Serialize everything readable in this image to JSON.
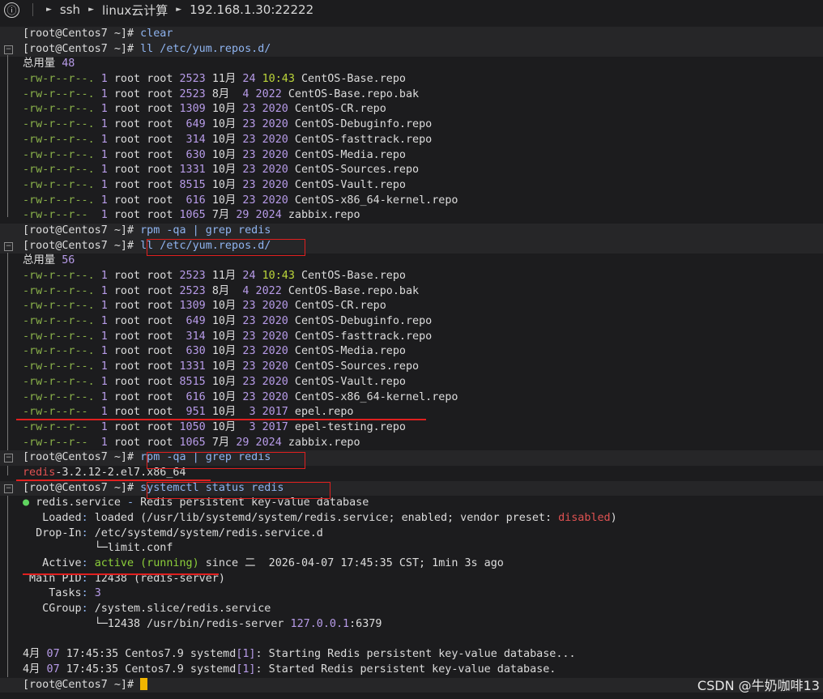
{
  "titlebar": {
    "info_icon_glyph": "ⓘ",
    "crumbs": [
      "ssh",
      "linux云计算",
      "192.168.1.30:22222"
    ]
  },
  "prompt": "[root@Centos7 ~]#",
  "watermark": "CSDN @牛奶咖啡13",
  "lines": [
    {
      "type": "prompt",
      "cmd": "clear"
    },
    {
      "type": "prompt",
      "cmd": "ll /etc/yum.repos.d/",
      "gutter": true
    },
    {
      "type": "total",
      "label": "总用量",
      "value": "48"
    },
    {
      "type": "file",
      "perm": "-rw-r--r--.",
      "links": "1",
      "owner": "root",
      "group": "root",
      "size": "2523",
      "mon": "11月",
      "day": "24",
      "t": "10:43",
      "tcolor": "time",
      "name": "CentOS-Base.repo"
    },
    {
      "type": "file",
      "perm": "-rw-r--r--.",
      "links": "1",
      "owner": "root",
      "group": "root",
      "size": "2523",
      "mon": "8月",
      "day": " 4",
      "t": "2022",
      "name": "CentOS-Base.repo.bak"
    },
    {
      "type": "file",
      "perm": "-rw-r--r--.",
      "links": "1",
      "owner": "root",
      "group": "root",
      "size": "1309",
      "mon": "10月",
      "day": "23",
      "t": "2020",
      "name": "CentOS-CR.repo"
    },
    {
      "type": "file",
      "perm": "-rw-r--r--.",
      "links": "1",
      "owner": "root",
      "group": "root",
      "size": " 649",
      "mon": "10月",
      "day": "23",
      "t": "2020",
      "name": "CentOS-Debuginfo.repo"
    },
    {
      "type": "file",
      "perm": "-rw-r--r--.",
      "links": "1",
      "owner": "root",
      "group": "root",
      "size": " 314",
      "mon": "10月",
      "day": "23",
      "t": "2020",
      "name": "CentOS-fasttrack.repo"
    },
    {
      "type": "file",
      "perm": "-rw-r--r--.",
      "links": "1",
      "owner": "root",
      "group": "root",
      "size": " 630",
      "mon": "10月",
      "day": "23",
      "t": "2020",
      "name": "CentOS-Media.repo"
    },
    {
      "type": "file",
      "perm": "-rw-r--r--.",
      "links": "1",
      "owner": "root",
      "group": "root",
      "size": "1331",
      "mon": "10月",
      "day": "23",
      "t": "2020",
      "name": "CentOS-Sources.repo"
    },
    {
      "type": "file",
      "perm": "-rw-r--r--.",
      "links": "1",
      "owner": "root",
      "group": "root",
      "size": "8515",
      "mon": "10月",
      "day": "23",
      "t": "2020",
      "name": "CentOS-Vault.repo"
    },
    {
      "type": "file",
      "perm": "-rw-r--r--.",
      "links": "1",
      "owner": "root",
      "group": "root",
      "size": " 616",
      "mon": "10月",
      "day": "23",
      "t": "2020",
      "name": "CentOS-x86_64-kernel.repo"
    },
    {
      "type": "file",
      "perm": "-rw-r--r-- ",
      "links": "1",
      "owner": "root",
      "group": "root",
      "size": "1065",
      "mon": "7月",
      "day": "29",
      "t": "2024",
      "name": "zabbix.repo"
    },
    {
      "type": "prompt",
      "cmd": "rpm -qa | grep redis"
    },
    {
      "type": "prompt",
      "cmd": "ll /etc/yum.repos.d/",
      "gutter": true
    },
    {
      "type": "total",
      "label": "总用量",
      "value": "56"
    },
    {
      "type": "file",
      "perm": "-rw-r--r--.",
      "links": "1",
      "owner": "root",
      "group": "root",
      "size": "2523",
      "mon": "11月",
      "day": "24",
      "t": "10:43",
      "tcolor": "time",
      "name": "CentOS-Base.repo"
    },
    {
      "type": "file",
      "perm": "-rw-r--r--.",
      "links": "1",
      "owner": "root",
      "group": "root",
      "size": "2523",
      "mon": "8月",
      "day": " 4",
      "t": "2022",
      "name": "CentOS-Base.repo.bak"
    },
    {
      "type": "file",
      "perm": "-rw-r--r--.",
      "links": "1",
      "owner": "root",
      "group": "root",
      "size": "1309",
      "mon": "10月",
      "day": "23",
      "t": "2020",
      "name": "CentOS-CR.repo"
    },
    {
      "type": "file",
      "perm": "-rw-r--r--.",
      "links": "1",
      "owner": "root",
      "group": "root",
      "size": " 649",
      "mon": "10月",
      "day": "23",
      "t": "2020",
      "name": "CentOS-Debuginfo.repo"
    },
    {
      "type": "file",
      "perm": "-rw-r--r--.",
      "links": "1",
      "owner": "root",
      "group": "root",
      "size": " 314",
      "mon": "10月",
      "day": "23",
      "t": "2020",
      "name": "CentOS-fasttrack.repo"
    },
    {
      "type": "file",
      "perm": "-rw-r--r--.",
      "links": "1",
      "owner": "root",
      "group": "root",
      "size": " 630",
      "mon": "10月",
      "day": "23",
      "t": "2020",
      "name": "CentOS-Media.repo"
    },
    {
      "type": "file",
      "perm": "-rw-r--r--.",
      "links": "1",
      "owner": "root",
      "group": "root",
      "size": "1331",
      "mon": "10月",
      "day": "23",
      "t": "2020",
      "name": "CentOS-Sources.repo"
    },
    {
      "type": "file",
      "perm": "-rw-r--r--.",
      "links": "1",
      "owner": "root",
      "group": "root",
      "size": "8515",
      "mon": "10月",
      "day": "23",
      "t": "2020",
      "name": "CentOS-Vault.repo"
    },
    {
      "type": "file",
      "perm": "-rw-r--r--.",
      "links": "1",
      "owner": "root",
      "group": "root",
      "size": " 616",
      "mon": "10月",
      "day": "23",
      "t": "2020",
      "name": "CentOS-x86_64-kernel.repo"
    },
    {
      "type": "file",
      "perm": "-rw-r--r-- ",
      "links": "1",
      "owner": "root",
      "group": "root",
      "size": " 951",
      "mon": "10月",
      "day": " 3",
      "t": "2017",
      "name": "epel.repo"
    },
    {
      "type": "file",
      "perm": "-rw-r--r-- ",
      "links": "1",
      "owner": "root",
      "group": "root",
      "size": "1050",
      "mon": "10月",
      "day": " 3",
      "t": "2017",
      "name": "epel-testing.repo"
    },
    {
      "type": "file",
      "perm": "-rw-r--r-- ",
      "links": "1",
      "owner": "root",
      "group": "root",
      "size": "1065",
      "mon": "7月",
      "day": "29",
      "t": "2024",
      "name": "zabbix.repo"
    },
    {
      "type": "prompt",
      "cmd": "rpm -qa | grep redis",
      "gutter": true
    },
    {
      "type": "rpm",
      "match": "redis",
      "rest": "-3.2.12-2.el7.x86_64"
    },
    {
      "type": "prompt",
      "cmd": "systemctl status redis",
      "gutter": true
    },
    {
      "type": "svc_head",
      "dot": "●",
      "unit": "redis.service",
      "dash": "-",
      "desc": "Redis persistent key-value database"
    },
    {
      "type": "kv",
      "key": "   Loaded",
      "val": "loaded (/usr/lib/systemd/system/redis.service; enabled; vendor preset: ",
      "val2": "disabled",
      ")": ")"
    },
    {
      "type": "kv",
      "key": "  Drop-In",
      "val": "/etc/systemd/system/redis.service.d"
    },
    {
      "type": "plain",
      "text": "           └─limit.conf"
    },
    {
      "type": "active",
      "key": "   Active",
      "state": "active (running)",
      "rest": " since 二  2026-04-07 17:45:35 CST; 1min 3s ago"
    },
    {
      "type": "kv",
      "key": " Main PID",
      "val": "12438 (redis-server)"
    },
    {
      "type": "kvnum",
      "key": "    Tasks",
      "val": "3"
    },
    {
      "type": "kv",
      "key": "   CGroup",
      "val": "/system.slice/redis.service"
    },
    {
      "type": "cg",
      "text": "           └─12438 /usr/bin/redis-server ",
      "addr": "127.0.0.1",
      "port": ":6379"
    },
    {
      "type": "blank"
    },
    {
      "type": "log",
      "mon": "4月",
      "day": " 07",
      "rest": " 17:45:35 Centos7.9 systemd",
      "pid": "[1]",
      "msg": ": Starting Redis persistent key-value database..."
    },
    {
      "type": "log",
      "mon": "4月",
      "day": " 07",
      "rest": " 17:45:35 Centos7.9 systemd",
      "pid": "[1]",
      "msg": ": Started Redis persistent key-value database."
    },
    {
      "type": "prompt",
      "cmd": "",
      "cursor": true
    }
  ]
}
